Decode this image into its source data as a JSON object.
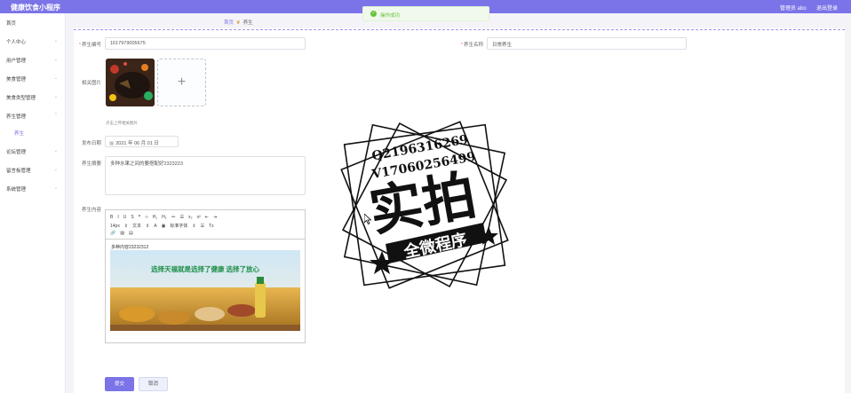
{
  "topbar": {
    "title": "健康饮食小程序",
    "admin": "管理员 abo",
    "logout": "退出登录"
  },
  "sidebar": {
    "items": [
      {
        "label": "首页",
        "chev": ""
      },
      {
        "label": "个人中心",
        "chev": "⌄"
      },
      {
        "label": "用户管理",
        "chev": "⌄"
      },
      {
        "label": "美食管理",
        "chev": "⌄"
      },
      {
        "label": "美食类型管理",
        "chev": "⌄"
      },
      {
        "label": "养生管理",
        "chev": "⌃"
      },
      {
        "label": "论坛管理",
        "chev": "⌄"
      },
      {
        "label": "留言板管理",
        "chev": "⌄"
      },
      {
        "label": "系统管理",
        "chev": "⌄"
      }
    ],
    "sub": "养生"
  },
  "breadcrumb": {
    "home": "首页",
    "current": "养生"
  },
  "toast": {
    "message": "操作成功"
  },
  "form": {
    "code_label": "养生编号",
    "code_value": "1617979005675",
    "name_label": "养生名称",
    "name_value": "日常养生",
    "image_label": "相关图片",
    "image_hint": "点击上传相关图片",
    "date_label": "发布日期",
    "date_value": "2021 年 06 月 01 日",
    "summary_label": "养生摘要",
    "summary_value": "多种水果之间的要搭配好2323223",
    "content_label": "养生内容",
    "content_text": "多种内容23232312",
    "submit": "提交",
    "cancel": "取消"
  },
  "editor": {
    "row1": [
      "B",
      "I",
      "U",
      "S",
      "❞",
      "‹›",
      "H₁",
      "H₂",
      "≔",
      "☰",
      "x₂",
      "x²",
      "⇤",
      "⇥"
    ],
    "row2": [
      "14px",
      "⇕",
      "文本",
      "⇕",
      "A",
      "▣",
      "标准字体",
      "⇕",
      "☰",
      "Tx"
    ],
    "row3": [
      "🔗",
      "▨",
      "▤"
    ],
    "banner_text": "选择天福就是选择了健康 选择了放心"
  },
  "watermark": {
    "line1": "Q2196316269",
    "line2": "V17060256499",
    "main": "实拍",
    "ribbon": "全微程序"
  },
  "colors": {
    "accent": "#7b73e8",
    "success": "#67c23a",
    "required": "#f56c6c"
  }
}
